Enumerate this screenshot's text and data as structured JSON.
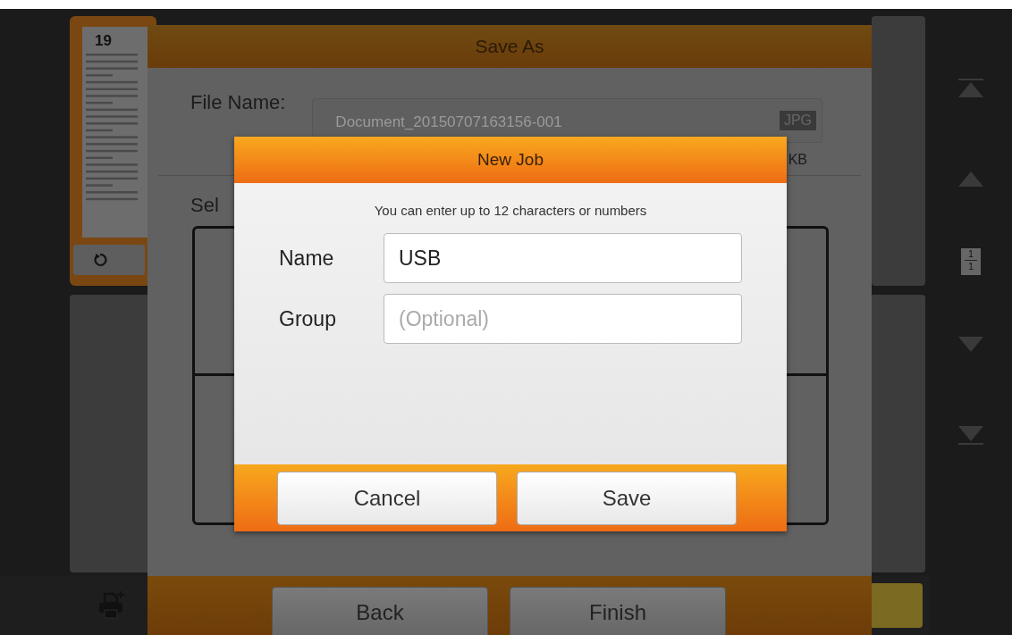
{
  "thumbnail": {
    "page_number": "19"
  },
  "nav": {
    "page_current": "1",
    "page_total": "1"
  },
  "save_as": {
    "title": "Save As",
    "file_name_label": "File Name:",
    "file_name": "Document_20150707163156-001",
    "format": "JPG",
    "size_unit": "KB",
    "select_label": "Sel",
    "buttons": [
      "Back",
      "Finish"
    ]
  },
  "new_job": {
    "title": "New Job",
    "hint": "You can enter up to 12 characters or numbers",
    "fields": [
      {
        "label": "Name",
        "value": "USB"
      },
      {
        "label": "Group",
        "placeholder": "(Optional)"
      }
    ],
    "buttons": [
      "Cancel",
      "Save"
    ]
  }
}
